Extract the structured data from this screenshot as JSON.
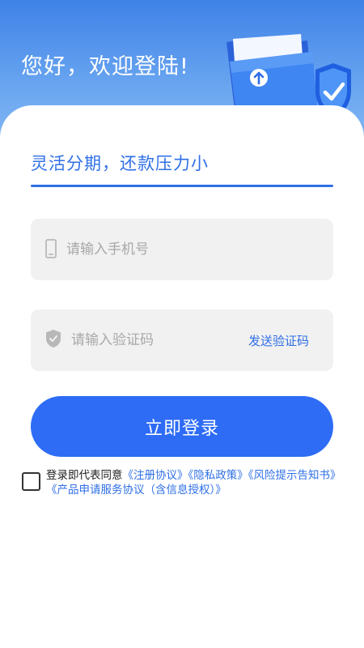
{
  "header": {
    "greeting": "您好，欢迎登陆!"
  },
  "form": {
    "slogan": "灵活分期，还款压力小",
    "phone_placeholder": "请输入手机号",
    "code_placeholder": "请输入验证码",
    "send_code_label": "发送验证码",
    "login_label": "立即登录"
  },
  "agreement": {
    "prefix": "登录即代表同意",
    "links": [
      "《注册协议》",
      "《隐私政策》",
      "《风险提示告知书》",
      "《产品申请服务协议（含信息授权）》"
    ],
    "checked": false
  },
  "icons": {
    "phone": "phone-icon",
    "shield": "shield-icon",
    "illustration": "folder-shield-illustration"
  },
  "colors": {
    "accent": "#2e6cf6",
    "link": "#2f6fe6",
    "header_top": "#3f82e8",
    "field_bg": "#f1f1f1"
  }
}
